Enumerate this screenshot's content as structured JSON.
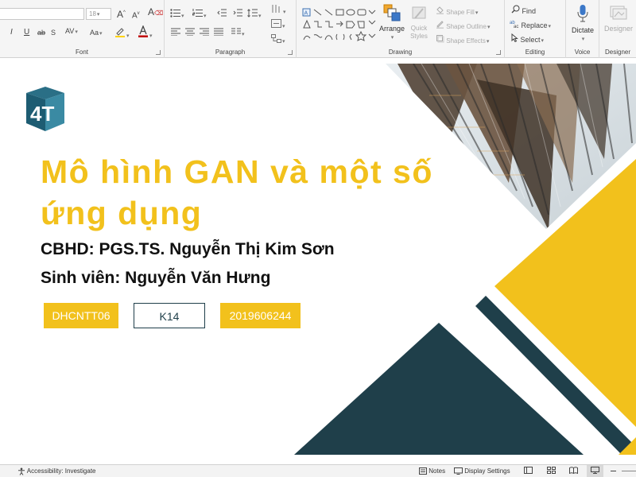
{
  "ribbon": {
    "font": {
      "label": "Font",
      "font_size": "18",
      "increase": "A",
      "decrease": "A",
      "italic": "I",
      "underline": "U",
      "strike": "ab",
      "spacing": "AV",
      "change_case": "Aa"
    },
    "paragraph": {
      "label": "Paragraph"
    },
    "drawing": {
      "label": "Drawing",
      "arrange": "Arrange",
      "quick_styles": "Quick Styles",
      "shape_fill": "Shape Fill",
      "shape_outline": "Shape Outline",
      "shape_effects": "Shape Effects"
    },
    "editing": {
      "label": "Editing",
      "find": "Find",
      "replace": "Replace",
      "select": "Select"
    },
    "voice": {
      "label": "Voice",
      "dictate": "Dictate"
    },
    "designer": {
      "label": "Designer",
      "designer": "Designer"
    }
  },
  "slide": {
    "title_line1": "Mô hình GAN và một số",
    "title_line2": "ứng dụng",
    "advisor": "CBHD: PGS.TS. Nguyễn Thị Kim Sơn",
    "student": "Sinh viên: Nguyễn Văn Hưng",
    "tags": [
      "DHCNTT06",
      "K14",
      "2019606244"
    ],
    "logo_text": "4T",
    "colors": {
      "accent_yellow": "#F2C11C",
      "teal_dark": "#1F3F4A"
    }
  },
  "statusbar": {
    "accessibility": "Accessibility: Investigate",
    "notes": "Notes",
    "display_settings": "Display Settings"
  }
}
